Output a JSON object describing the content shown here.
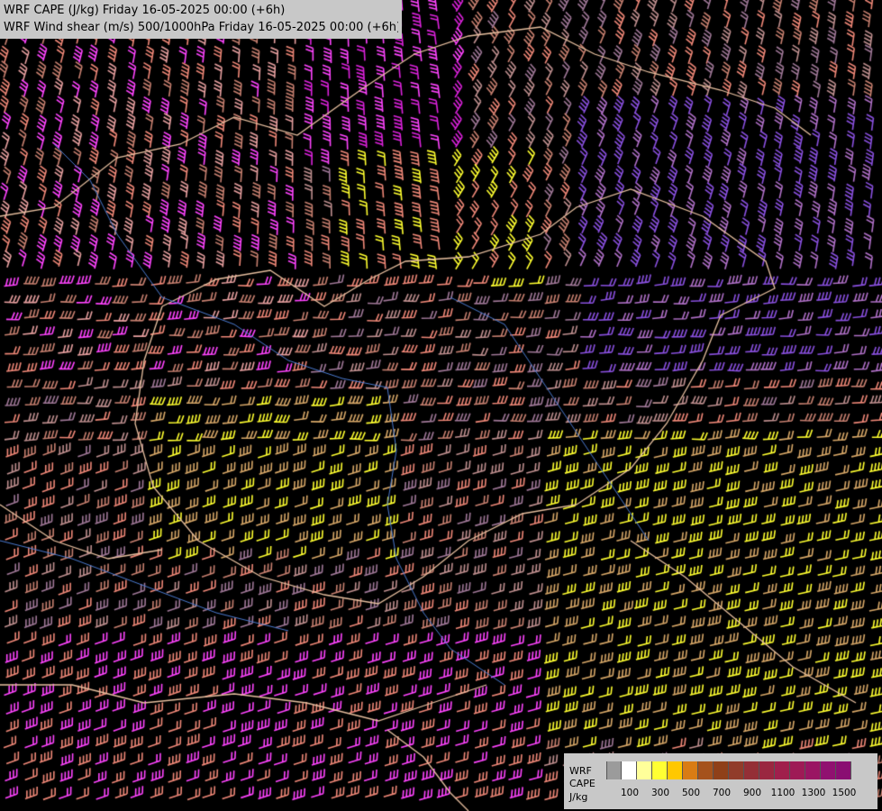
{
  "title": {
    "line1": "WRF CAPE (J/kg) Friday 16-05-2025 00:00 (+6h)",
    "line2": "WRF Wind shear (m/s) 500/1000hPa Friday 16-05-2025 00:00 (+6h)"
  },
  "legend": {
    "label_model": "WRF",
    "label_field": "CAPE",
    "label_unit": "J/kg",
    "tick_labels": [
      "100",
      "300",
      "500",
      "700",
      "900",
      "1100",
      "1300",
      "1500"
    ],
    "colors": [
      "#9b9b9b",
      "#ffffff",
      "#ffff9a",
      "#ffff33",
      "#ffc800",
      "#d97c14",
      "#a5521c",
      "#8f4019",
      "#913c2a",
      "#942f36",
      "#9a2740",
      "#a01f4c",
      "#9e1a56",
      "#9a1563",
      "#901170",
      "#8a0e72"
    ]
  },
  "barb_colors": [
    "#ff44ff",
    "#dd22dd",
    "#f08878",
    "#c88070",
    "#e8a0a0",
    "#ffff30",
    "#ffe040",
    "#d8a868",
    "#b070c8",
    "#8a50e0",
    "#a07898",
    "#c09090"
  ],
  "border_color": "#e8c0a0",
  "river_color": "#4a7ad0"
}
